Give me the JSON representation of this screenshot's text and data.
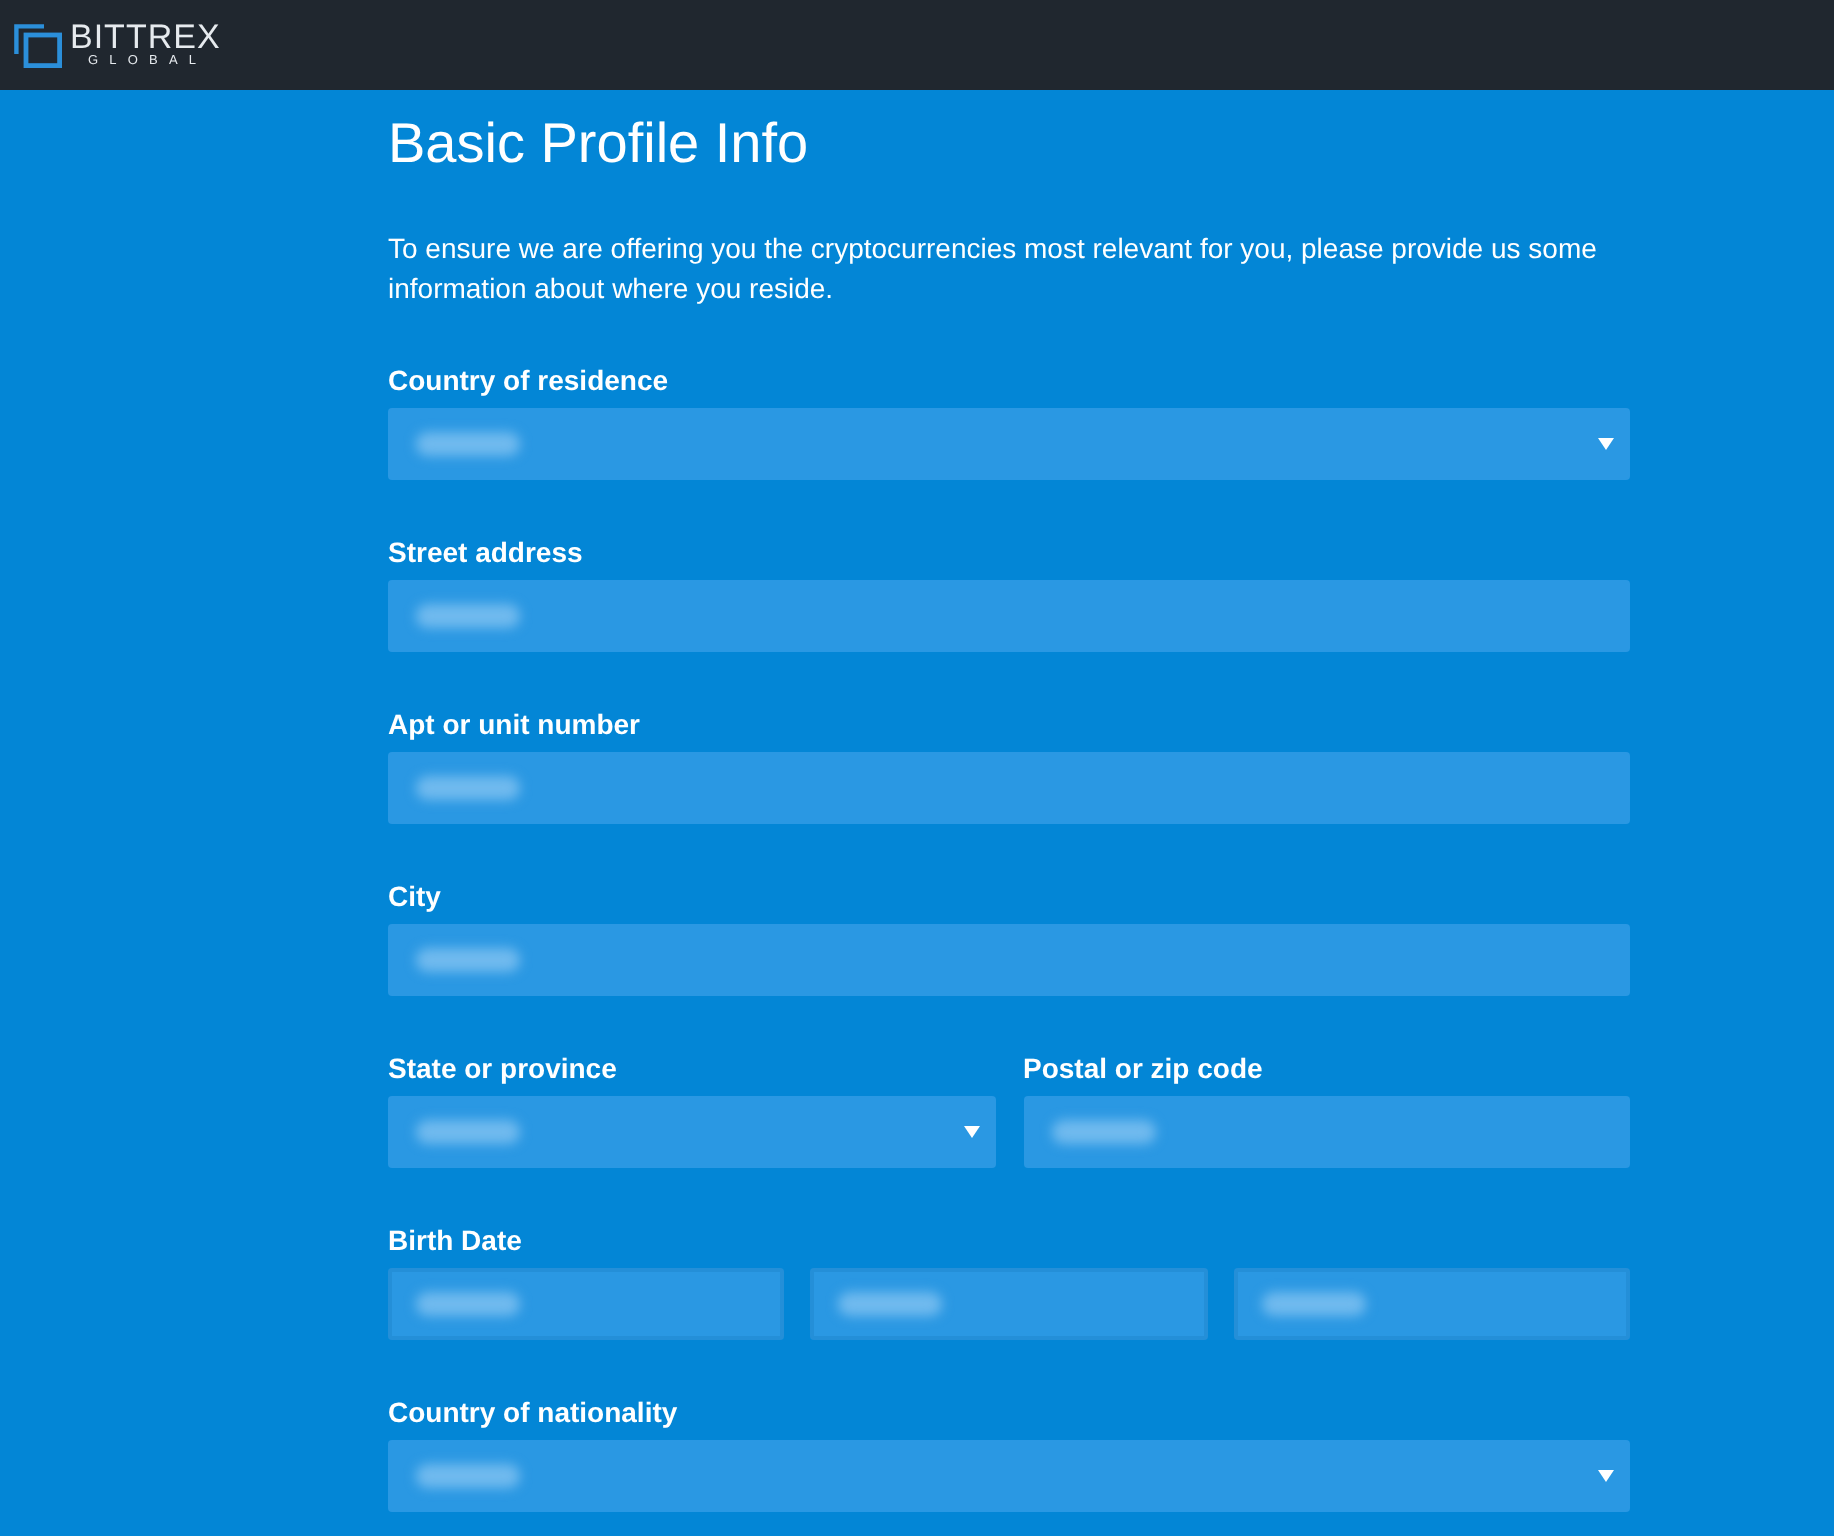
{
  "header": {
    "logo": {
      "name": "BITTREX",
      "subtitle": "GLOBAL"
    }
  },
  "form": {
    "title": "Basic Profile Info",
    "intro": "To ensure we are offering you the cryptocurrencies most relevant for you, please provide us some information about where you reside.",
    "rows": [
      {
        "groups": [
          {
            "label": "Country of residence",
            "inputs": [
              {
                "kind": "select",
                "redacted": true
              }
            ]
          }
        ]
      },
      {
        "groups": [
          {
            "label": "Street address",
            "inputs": [
              {
                "kind": "text",
                "redacted": true
              }
            ]
          }
        ]
      },
      {
        "groups": [
          {
            "label": "Apt or unit number",
            "inputs": [
              {
                "kind": "text",
                "redacted": true
              }
            ]
          }
        ]
      },
      {
        "groups": [
          {
            "label": "City",
            "inputs": [
              {
                "kind": "text",
                "redacted": true
              }
            ]
          }
        ]
      },
      {
        "groups": [
          {
            "label": "State or province",
            "inputs": [
              {
                "kind": "select",
                "redacted": true
              }
            ]
          },
          {
            "label": "Postal or zip code",
            "inputs": [
              {
                "kind": "text",
                "redacted": true
              }
            ]
          }
        ]
      },
      {
        "groups": [
          {
            "label": "Birth Date",
            "inputs": [
              {
                "kind": "date_part",
                "redacted": true
              },
              {
                "kind": "date_part",
                "redacted": true
              },
              {
                "kind": "date_part",
                "redacted": true
              }
            ]
          }
        ]
      },
      {
        "groups": [
          {
            "label": "Country of nationality",
            "inputs": [
              {
                "kind": "select",
                "redacted": true
              }
            ]
          }
        ]
      }
    ]
  }
}
